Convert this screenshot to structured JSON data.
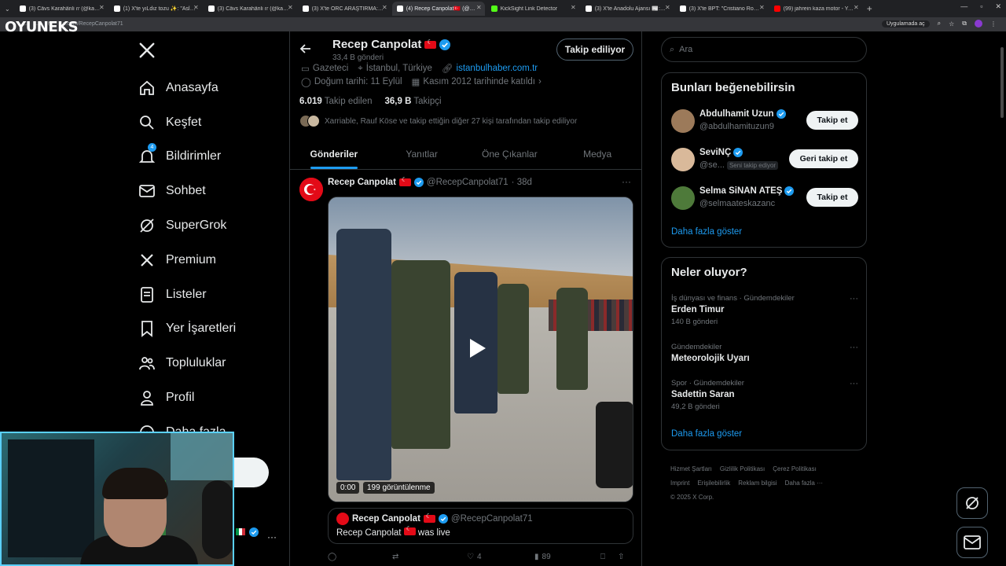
{
  "browser": {
    "tabs": [
      {
        "title": "(3) Cävs Karahänli ɾɾ (@karahan",
        "color": "#ffffff"
      },
      {
        "title": "(1) X'te yıLdız tozu ✨: \"Asla evi",
        "color": "#ffffff"
      },
      {
        "title": "(3) Cävs Karahänli ɾɾ (@karahan",
        "color": "#ffffff"
      },
      {
        "title": "(3) X'te ORC ARAŞTIRMA: \"SİVİ",
        "color": "#ffffff"
      },
      {
        "title": "(4) Recep Canpolat🇹🇷 (@Recep",
        "color": "#ffffff"
      },
      {
        "title": "KickSight Link Detector",
        "color": "#53fc18"
      },
      {
        "title": "(3) X'te Anadolu Ajansı 📰: \"Kuzu",
        "color": "#ffffff"
      },
      {
        "title": "(3) X'te BPT: \"Cristiano Ronaldo",
        "color": "#ffffff"
      },
      {
        "title": "(99) jahrein kaza motor - YouTu",
        "color": "#ff0000"
      }
    ],
    "active_tab_index": 4,
    "url": "x.com/RecepCanpolat71",
    "extension_pill": "Uygulamada aç",
    "brand_overlay": "OYUNEKS"
  },
  "nav": {
    "items": [
      {
        "label": "Anasayfa",
        "icon": "home-icon",
        "name": "home"
      },
      {
        "label": "Keşfet",
        "icon": "search-icon",
        "name": "explore"
      },
      {
        "label": "Bildirimler",
        "icon": "bell-icon",
        "name": "notifications",
        "badge": "4"
      },
      {
        "label": "Sohbet",
        "icon": "mail-icon",
        "name": "chat"
      },
      {
        "label": "SuperGrok",
        "icon": "grok-icon",
        "name": "supergrok"
      },
      {
        "label": "Premium",
        "icon": "x-icon",
        "name": "premium"
      },
      {
        "label": "Listeler",
        "icon": "list-icon",
        "name": "lists"
      },
      {
        "label": "Yer İşaretleri",
        "icon": "bookmark-icon",
        "name": "bookmarks"
      },
      {
        "label": "Topluluklar",
        "icon": "people-icon",
        "name": "communities"
      },
      {
        "label": "Profil",
        "icon": "person-icon",
        "name": "profile"
      },
      {
        "label": "Daha fazla",
        "icon": "more-circle-icon",
        "name": "more"
      }
    ],
    "post_button_fragment": "a"
  },
  "profile": {
    "name": "Recep Canpolat",
    "post_count": "33,4 B gönderi",
    "follow_button": "Takip ediliyor",
    "job": "Gazeteci",
    "location": "İstanbul, Türkiye",
    "website": "istanbulhaber.com.tr",
    "birthday": "Doğum tarihi: 11 Eylül",
    "joined": "Kasım 2012 tarihinde katıldı",
    "following_count": "6.019",
    "following_label": "Takip edilen",
    "followers_count": "36,9 B",
    "followers_label": "Takipçi",
    "known_followers": "Xarriable, Rauf Köse ve takip ettiğin diğer 27 kişi tarafından takip ediliyor",
    "tabs": [
      "Gönderiler",
      "Yanıtlar",
      "Öne Çıkanlar",
      "Medya"
    ]
  },
  "tweet": {
    "author": "Recep Canpolat",
    "handle": "@RecepCanpolat71",
    "age": "· 38d",
    "video_time": "0:00",
    "video_views": "199 görüntülenme",
    "quote_author": "Recep Canpolat",
    "quote_handle": "@RecepCanpolat71",
    "quote_text_name": "Recep Canpolat",
    "quote_text_suffix": "was live",
    "likes": "4",
    "views": "89"
  },
  "right": {
    "search_placeholder": "Ara",
    "suggest_title": "Bunları beğenebilirsin",
    "suggestions": [
      {
        "name": "Abdulhamit Uzun",
        "handle": "@abdulhamituzun9",
        "button": "Takip et",
        "avatar_color": "#9c7a5a"
      },
      {
        "name": "SeviNÇ",
        "handle": "@se...",
        "tag": "Seni takip ediyor",
        "button": "Geri takip et",
        "avatar_color": "#d9b99a"
      },
      {
        "name": "Selma SiNAN ATEŞ",
        "handle": "@selmaateskazanc",
        "button": "Takip et",
        "avatar_color": "#4e7a3a"
      }
    ],
    "show_more": "Daha fazla göster",
    "trends_title": "Neler oluyor?",
    "trends": [
      {
        "category": "İş dünyası ve finans · Gündemdekiler",
        "title": "Erden Timur",
        "count": "140 B gönderi"
      },
      {
        "category": "Gündemdekiler",
        "title": "Meteorolojik Uyarı",
        "count": ""
      },
      {
        "category": "Spor · Gündemdekiler",
        "title": "Sadettin Saran",
        "count": "49,2 B gönderi"
      }
    ],
    "trends_more": "Daha fazla göster",
    "footer_links": [
      "Hizmet Şartları",
      "Gizlilik Politikası",
      "Çerez Politikası",
      "Imprint",
      "Erişilebilirlik",
      "Reklam bilgisi",
      "Daha fazla ···"
    ],
    "copyright": "© 2025 X Corp."
  },
  "colors": {
    "accent": "#1d9bf0",
    "background": "#000000",
    "border": "#2f3336"
  }
}
